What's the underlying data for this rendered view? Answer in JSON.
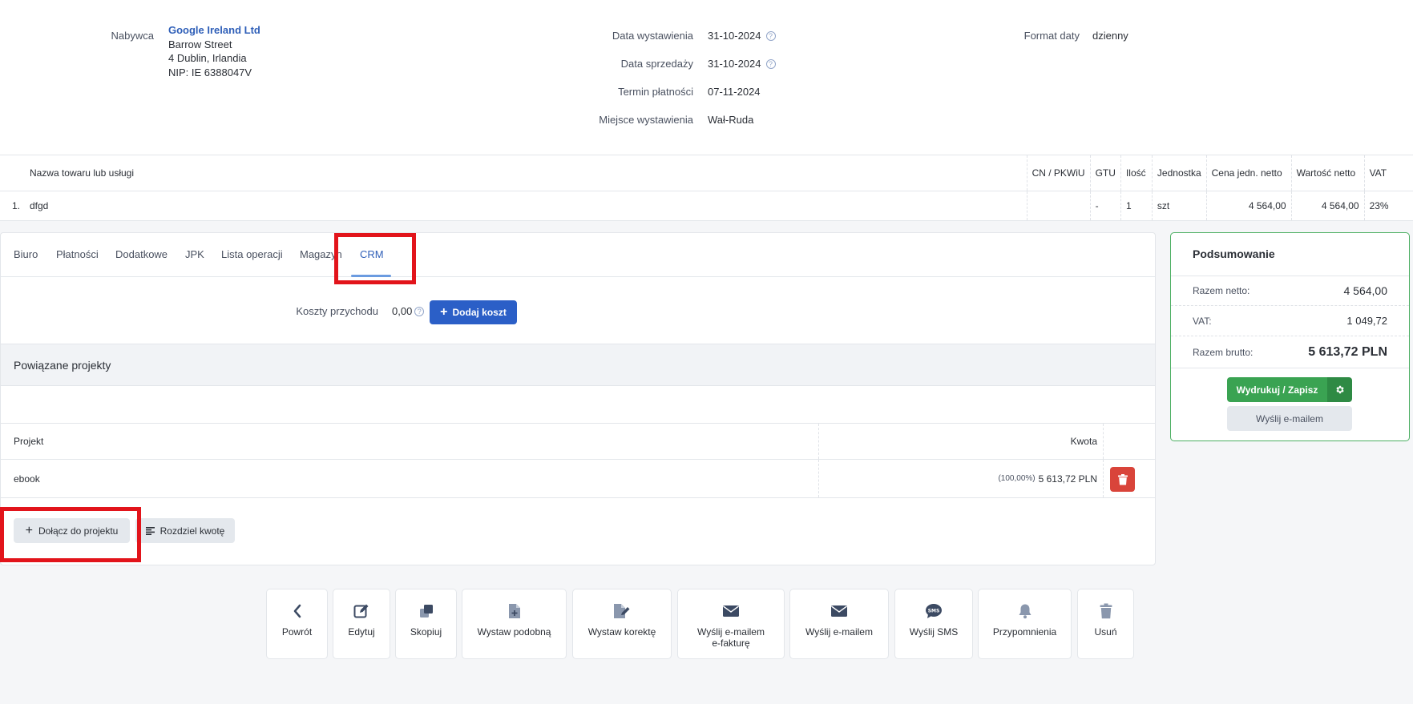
{
  "invoice": {
    "buyer_label": "Nabywca",
    "buyer_name": "Google Ireland Ltd",
    "buyer_street": "Barrow Street",
    "buyer_city": "4 Dublin, Irlandia",
    "buyer_nip": "NIP: IE 6388047V",
    "issue_date_label": "Data wystawienia",
    "issue_date": "31-10-2024",
    "sale_date_label": "Data sprzedaży",
    "sale_date": "31-10-2024",
    "payment_due_label": "Termin płatności",
    "payment_due": "07-11-2024",
    "place_label": "Miejsce wystawienia",
    "place": "Wał-Ruda",
    "date_format_label": "Format daty",
    "date_format": "dzienny"
  },
  "items_table": {
    "headers": [
      "Nazwa towaru lub usługi",
      "CN / PKWiU",
      "GTU",
      "Ilość",
      "Jednostka",
      "Cena jedn.  netto",
      "Wartość netto",
      "VAT"
    ],
    "rows": [
      {
        "lp": "1.",
        "name": "dfgd",
        "cn": "",
        "gtu": "-",
        "qty": "1",
        "unit": "szt",
        "unit_price": "4 564,00",
        "net_value": "4 564,00",
        "vat": "23%"
      }
    ]
  },
  "tabs": [
    "Biuro",
    "Płatności",
    "Dodatkowe",
    "JPK",
    "Lista operacji",
    "Magazyn",
    "CRM"
  ],
  "active_tab": "CRM",
  "crm": {
    "cost_label": "Koszty przychodu",
    "cost_value": "0,00",
    "add_cost_button": "Dodaj koszt",
    "related_projects_title": "Powiązane projekty",
    "col_project": "Projekt",
    "col_amount": "Kwota",
    "projects": [
      {
        "name": "ebook",
        "percent": "(100,00%)",
        "amount": "5 613,72 PLN"
      }
    ],
    "join_project_button": "Dołącz do projektu",
    "split_amount_button": "Rozdziel kwotę"
  },
  "summary": {
    "title": "Podsumowanie",
    "net_label": "Razem netto:",
    "net_value": "4 564,00",
    "vat_label": "VAT:",
    "vat_value": "1 049,72",
    "gross_label": "Razem brutto:",
    "gross_value": "5 613,72 PLN",
    "print_button": "Wydrukuj / Zapisz",
    "email_button": "Wyślij e-mailem"
  },
  "toolbar": [
    {
      "label": "Powrót",
      "icon": "chevron-left-icon"
    },
    {
      "label": "Edytuj",
      "icon": "edit-icon"
    },
    {
      "label": "Skopiuj",
      "icon": "copy-icon"
    },
    {
      "label": "Wystaw podobną",
      "icon": "file-plus-icon"
    },
    {
      "label": "Wystaw korektę",
      "icon": "file-edit-icon"
    },
    {
      "label": "Wyślij e-mailem\ne-fakturę",
      "icon": "envelope-icon"
    },
    {
      "label": "Wyślij e-mailem",
      "icon": "envelope-icon"
    },
    {
      "label": "Wyślij SMS",
      "icon": "sms-icon"
    },
    {
      "label": "Przypomnienia",
      "icon": "bell-icon"
    },
    {
      "label": "Usuń",
      "icon": "trash-icon"
    }
  ],
  "colors": {
    "accent_blue": "#2b5fc7",
    "green": "#3aa352",
    "danger": "#d9443a",
    "highlight_red": "#e2141b"
  }
}
